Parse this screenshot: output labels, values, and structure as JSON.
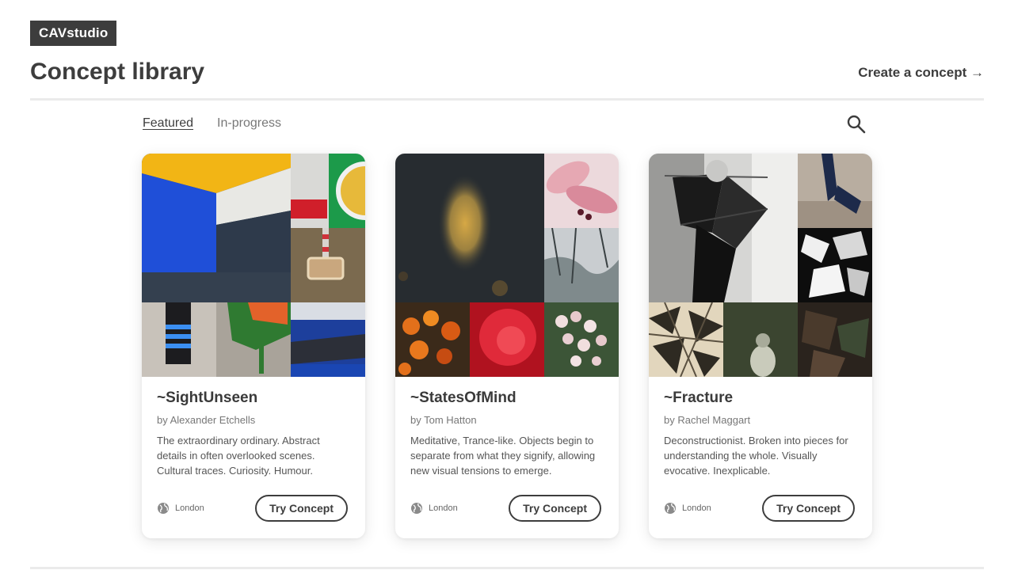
{
  "header": {
    "logo": "CAVstudio",
    "title": "Concept library",
    "create_link": "Create a concept →"
  },
  "tabs": [
    {
      "label": "Featured",
      "active": true
    },
    {
      "label": "In-progress",
      "active": false
    }
  ],
  "search": {
    "icon": "search-icon"
  },
  "cards": [
    {
      "title": "~SightUnseen",
      "author": "by Alexander Etchells",
      "description": "The extraordinary ordinary. Abstract details in often overlooked scenes. Cultural traces. Curiosity. Humour.",
      "location": "London",
      "button": "Try Concept"
    },
    {
      "title": "~StatesOfMind",
      "author": "by Tom Hatton",
      "description": "Meditative, Trance-like. Objects begin to separate from what they signify, allowing new visual tensions to emerge.",
      "location": "London",
      "button": "Try Concept"
    },
    {
      "title": "~Fracture",
      "author": "by Rachel Maggart",
      "description": "Deconstructionist. Broken into pieces for understanding the whole. Visually evocative. Inexplicable.",
      "location": "London",
      "button": "Try Concept"
    }
  ]
}
